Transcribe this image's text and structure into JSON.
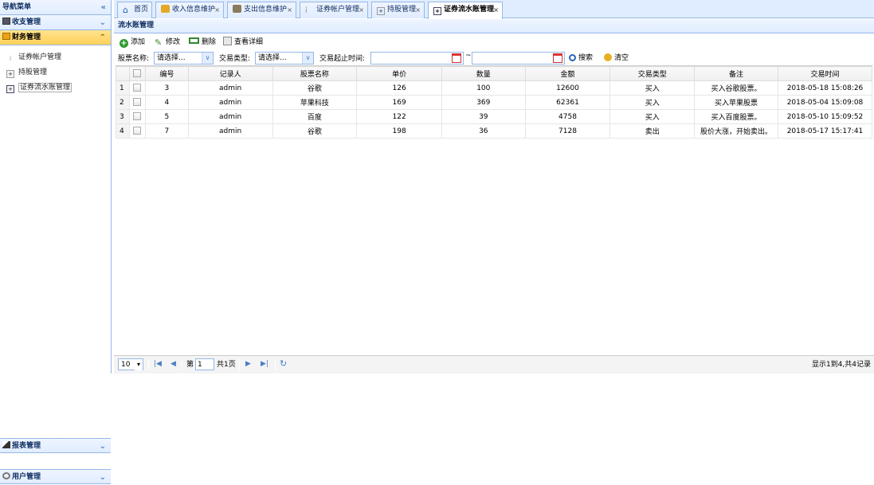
{
  "sidebar": {
    "title": "导航菜单",
    "sections": [
      {
        "label": "收支管理"
      },
      {
        "label": "财务管理",
        "items": [
          {
            "label": "证券帐户管理"
          },
          {
            "label": "持股管理"
          },
          {
            "label": "证券流水账管理"
          }
        ]
      },
      {
        "label": "报表管理"
      },
      {
        "label": "用户管理"
      }
    ]
  },
  "tabs": [
    {
      "label": "首页"
    },
    {
      "label": "收入信息维护"
    },
    {
      "label": "支出信息维护"
    },
    {
      "label": "证券帐户管理"
    },
    {
      "label": "持股管理"
    },
    {
      "label": "证券流水账管理"
    }
  ],
  "panel": {
    "title": "流水账管理"
  },
  "toolbar": {
    "add": "添加",
    "edit": "修改",
    "delete": "删除",
    "detail": "查看详细"
  },
  "filters": {
    "stock_label": "股票名称:",
    "stock_value": "请选择...",
    "type_label": "交易类型:",
    "type_value": "请选择...",
    "time_label": "交易起止时间:",
    "tilde": "~",
    "search": "搜索",
    "clear": "清空"
  },
  "grid": {
    "columns": [
      "编号",
      "记录人",
      "股票名称",
      "单价",
      "数量",
      "金额",
      "交易类型",
      "备注",
      "交易时间"
    ],
    "rows": [
      {
        "rn": "1",
        "id": "3",
        "recorder": "admin",
        "stock": "谷歌",
        "price": "126",
        "qty": "100",
        "amount": "12600",
        "type": "买入",
        "note": "买入谷歌股票。",
        "time": "2018-05-18 15:08:26"
      },
      {
        "rn": "2",
        "id": "4",
        "recorder": "admin",
        "stock": "苹果科技",
        "price": "169",
        "qty": "369",
        "amount": "62361",
        "type": "买入",
        "note": "买入苹果股票",
        "time": "2018-05-04 15:09:08"
      },
      {
        "rn": "3",
        "id": "5",
        "recorder": "admin",
        "stock": "百度",
        "price": "122",
        "qty": "39",
        "amount": "4758",
        "type": "买入",
        "note": "买入百度股票。",
        "time": "2018-05-10 15:09:52"
      },
      {
        "rn": "4",
        "id": "7",
        "recorder": "admin",
        "stock": "谷歌",
        "price": "198",
        "qty": "36",
        "amount": "7128",
        "type": "卖出",
        "note": "股价大涨，开始卖出。",
        "time": "2018-05-17 15:17:41"
      }
    ]
  },
  "pager": {
    "page_size": "10",
    "page_prefix": "第",
    "page_value": "1",
    "page_suffix": "共1页",
    "summary": "显示1到4,共4记录"
  },
  "icons": {
    "home": "home-icon",
    "add": "plus-circle-icon",
    "edit": "pencil-icon",
    "delete": "minus-icon",
    "detail": "document-icon",
    "search": "magnifier-icon",
    "clear": "broom-icon",
    "calendar": "calendar-icon"
  },
  "colors": {
    "border": "#95b8e7",
    "header_bg": "#e0ecff",
    "selected_section": "#ffd05b"
  }
}
